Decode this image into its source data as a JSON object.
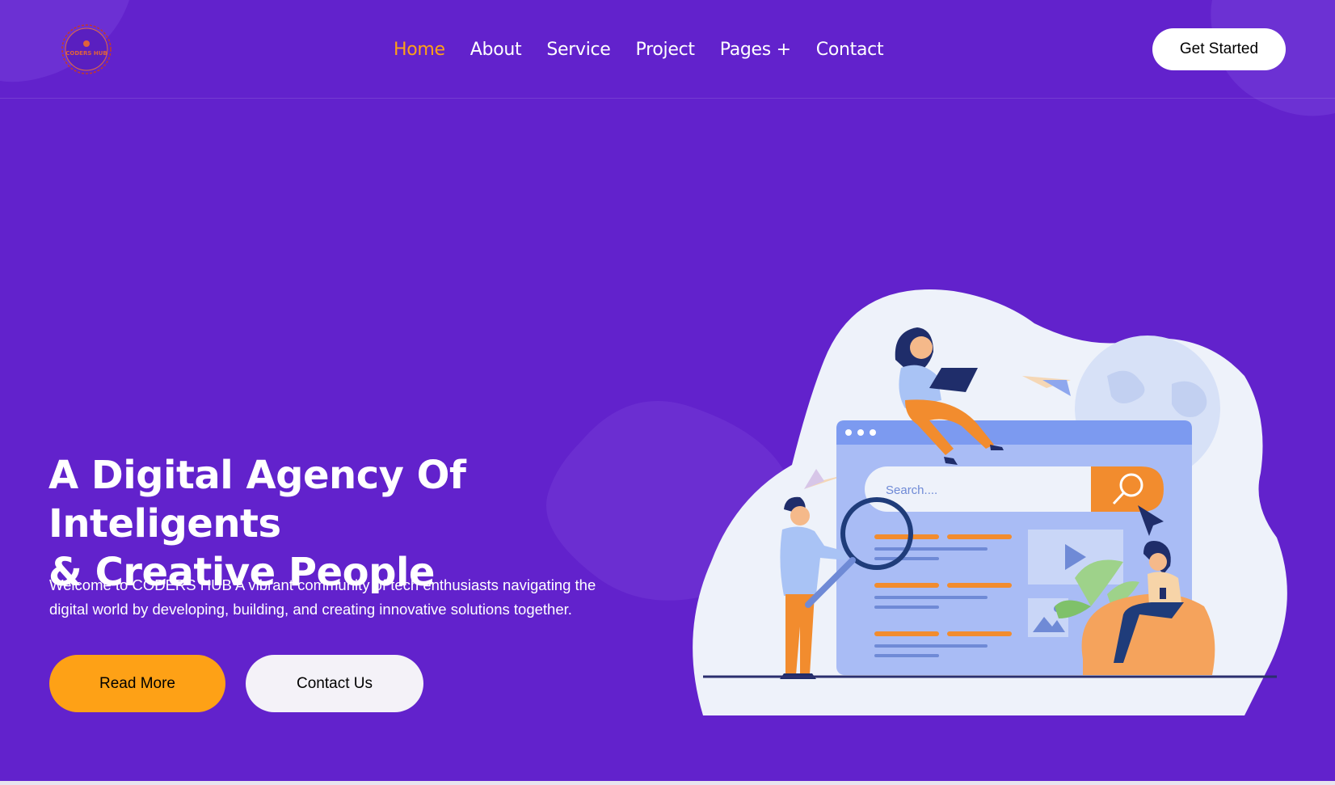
{
  "brand": {
    "logo_text": "CODERS HUB"
  },
  "nav": {
    "items": [
      {
        "label": "Home",
        "active": true
      },
      {
        "label": "About"
      },
      {
        "label": "Service"
      },
      {
        "label": "Project"
      },
      {
        "label": "Pages +"
      },
      {
        "label": "Contact"
      }
    ],
    "cta_label": "Get Started"
  },
  "hero": {
    "title_line1": "A Digital Agency Of Inteligents",
    "title_line2": "& Creative People",
    "description_line1": "Welcome to CODERS HUB A vibrant community of tech enthusiasts navigating the",
    "description_line2": "digital world by developing, building, and creating innovative solutions together.",
    "read_more_label": "Read More",
    "contact_label": "Contact Us"
  },
  "illustration": {
    "search_placeholder": "Search...."
  },
  "colors": {
    "background": "#6222cc",
    "accent": "#fea116",
    "illustration_blob": "#eef2fa",
    "browser": "#a9bcf5"
  }
}
